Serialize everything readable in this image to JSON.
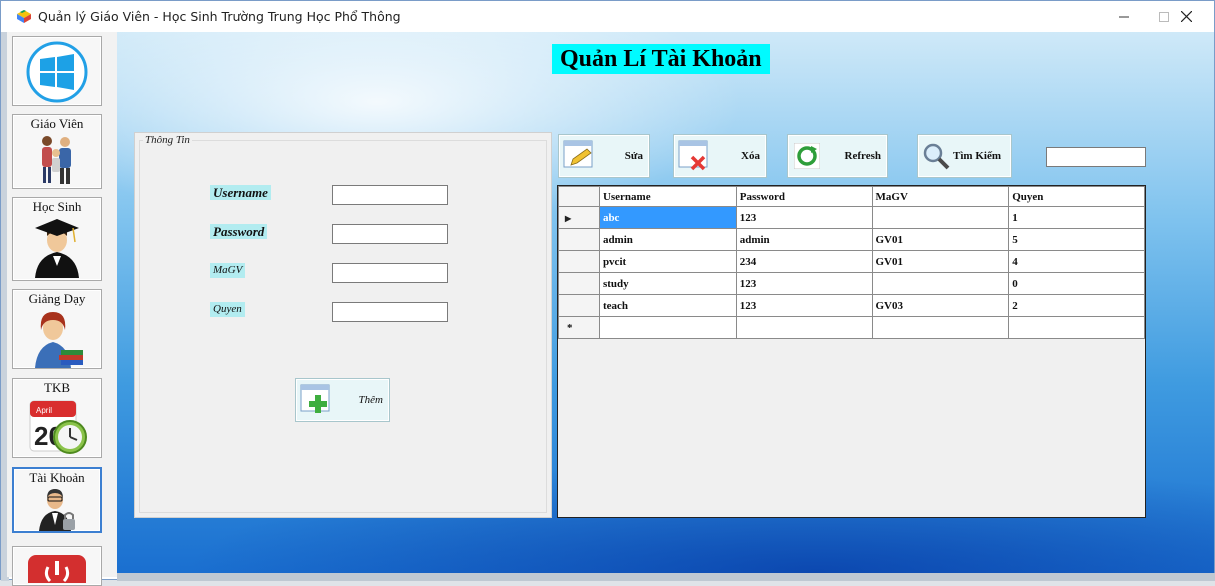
{
  "window": {
    "title": "Quản lý Giáo Viên - Học Sinh Trường Trung Học Phổ Thông",
    "minimize": "—",
    "maximize": "☐",
    "close": "✕"
  },
  "sidebar": {
    "items": [
      {
        "label": "",
        "icon": "windows-logo-icon"
      },
      {
        "label": "Giáo Viên",
        "icon": "teachers-icon"
      },
      {
        "label": "Học Sinh",
        "icon": "graduate-icon"
      },
      {
        "label": "Giảng Dạy",
        "icon": "teacher-books-icon"
      },
      {
        "label": "TKB",
        "icon": "calendar-clock-icon"
      },
      {
        "label": "Tài Khoản",
        "icon": "user-lock-icon"
      },
      {
        "label": "",
        "icon": "exit-icon"
      }
    ],
    "calendar_month": "April",
    "calendar_day": "20"
  },
  "main": {
    "title": "Quản Lí Tài Khoản"
  },
  "form": {
    "legend": "Thông Tin",
    "username_label": "Username",
    "password_label": "Password",
    "magv_label": "MaGV",
    "quyen_label": "Quyen",
    "username_value": "",
    "password_value": "",
    "magv_value": "",
    "quyen_value": "",
    "add_label": "Thêm"
  },
  "toolbar": {
    "edit_label": "Sửa",
    "delete_label": "Xóa",
    "refresh_label": "Refresh",
    "search_label": "Tìm Kiếm",
    "search_value": ""
  },
  "grid": {
    "columns": [
      "Username",
      "Password",
      "MaGV",
      "Quyen"
    ],
    "rows": [
      [
        "abc",
        "123",
        "",
        "1"
      ],
      [
        "admin",
        "admin",
        "GV01",
        "5"
      ],
      [
        "pvcit",
        "234",
        "GV01",
        "4"
      ],
      [
        "study",
        "123",
        "",
        "0"
      ],
      [
        "teach",
        "123",
        "GV03",
        "2"
      ]
    ],
    "current_row_marker": "▶",
    "new_row_marker": "*"
  },
  "colors": {
    "title_bg": "#00fbff",
    "label_bg": "#b2ecf0",
    "selected_cell": "#3399ff",
    "active_nav_border": "#3c7fd1"
  }
}
